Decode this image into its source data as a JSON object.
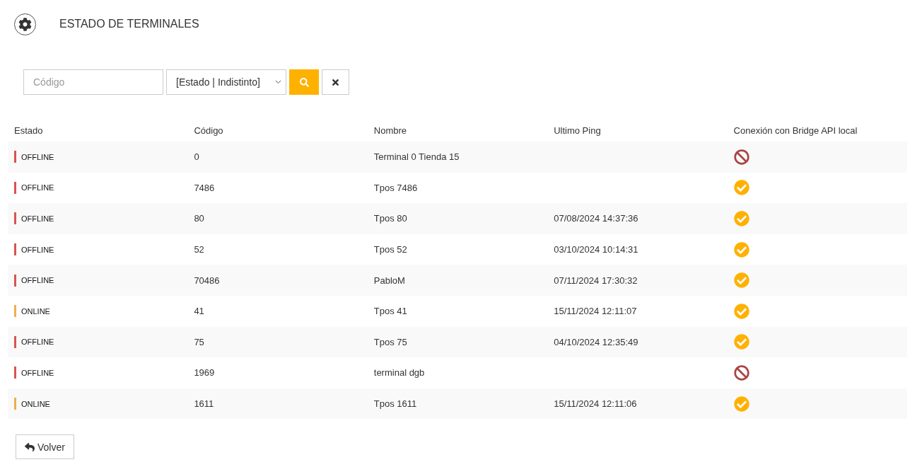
{
  "header": {
    "title": "ESTADO DE TERMINALES"
  },
  "filters": {
    "code_placeholder": "Código",
    "status_select": "[Estado | Indistinto]"
  },
  "table": {
    "columns": [
      "Estado",
      "Código",
      "Nombre",
      "Ultimo Ping",
      "Conexión con Bridge API local"
    ],
    "rows": [
      {
        "status": "OFFLINE",
        "color": "#d9534f",
        "code": "0",
        "name": "Terminal 0 Tienda 15",
        "last_ping": "",
        "bridge_connected": false
      },
      {
        "status": "OFFLINE",
        "color": "#d9534f",
        "code": "7486",
        "name": "Tpos 7486",
        "last_ping": "",
        "bridge_connected": true
      },
      {
        "status": "OFFLINE",
        "color": "#d9534f",
        "code": "80",
        "name": "Tpos 80",
        "last_ping": "07/08/2024 14:37:36",
        "bridge_connected": true
      },
      {
        "status": "OFFLINE",
        "color": "#d9534f",
        "code": "52",
        "name": "Tpos 52",
        "last_ping": "03/10/2024 10:14:31",
        "bridge_connected": true
      },
      {
        "status": "OFFLINE",
        "color": "#d9534f",
        "code": "70486",
        "name": "PabloM",
        "last_ping": "07/11/2024 17:30:32",
        "bridge_connected": true
      },
      {
        "status": "ONLINE",
        "color": "#f0ad4e",
        "code": "41",
        "name": "Tpos 41",
        "last_ping": "15/11/2024 12:11:07",
        "bridge_connected": true
      },
      {
        "status": "OFFLINE",
        "color": "#d9534f",
        "code": "75",
        "name": "Tpos 75",
        "last_ping": "04/10/2024 12:35:49",
        "bridge_connected": true
      },
      {
        "status": "OFFLINE",
        "color": "#d9534f",
        "code": "1969",
        "name": "terminal dgb",
        "last_ping": "",
        "bridge_connected": false
      },
      {
        "status": "ONLINE",
        "color": "#f0ad4e",
        "code": "1611",
        "name": "Tpos 1611",
        "last_ping": "15/11/2024 12:11:06",
        "bridge_connected": true
      }
    ]
  },
  "back_button": "Volver"
}
